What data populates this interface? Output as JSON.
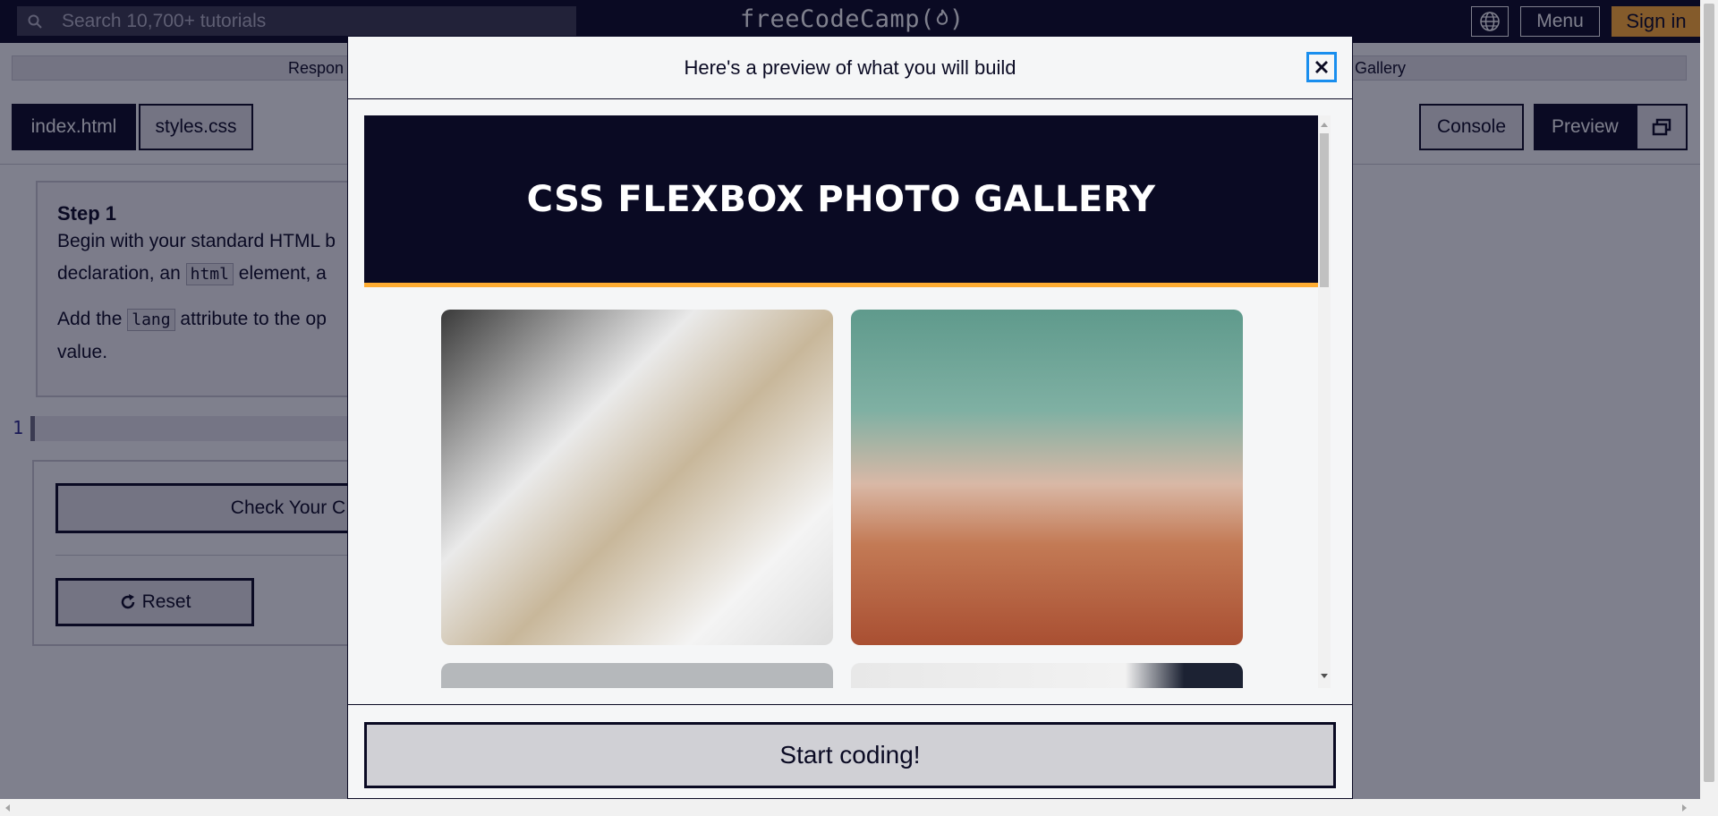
{
  "nav": {
    "search_placeholder": "Search 10,700+ tutorials",
    "logo_text": "freeCodeCamp(",
    "logo_close": ")",
    "menu_label": "Menu",
    "signin_label": "Sign in",
    "icons": [
      "search-icon",
      "flame-icon",
      "globe-icon"
    ]
  },
  "breadcrumb": {
    "left": "Respon",
    "right": "Gallery"
  },
  "editor": {
    "tabs": [
      "index.html",
      "styles.css"
    ],
    "console_label": "Console",
    "preview_label": "Preview",
    "line_number": "1"
  },
  "instructions": {
    "title": "Step 1",
    "line1": "Begin with your standard HTML b",
    "line2_a": "declaration, an ",
    "line2_code": "html",
    "line2_b": " element, a ",
    "line3_a": "Add the ",
    "line3_code": "lang",
    "line3_b": " attribute to the op",
    "line4": "value."
  },
  "actions": {
    "check_label": "Check Your C",
    "reset_label": "Reset"
  },
  "modal": {
    "title": "Here's a preview of what you will build",
    "gallery_title": "CSS FLEXBOX PHOTO GALLERY",
    "start_label": "Start coding!",
    "photos": [
      "sleeping-tabby-cat",
      "cat-lying-on-back",
      "photo-3",
      "photo-4"
    ]
  },
  "colors": {
    "nav_bg": "#0a0a23",
    "accent": "#feac32",
    "focus": "#198eee",
    "page_bg": "#f5f6f7"
  }
}
